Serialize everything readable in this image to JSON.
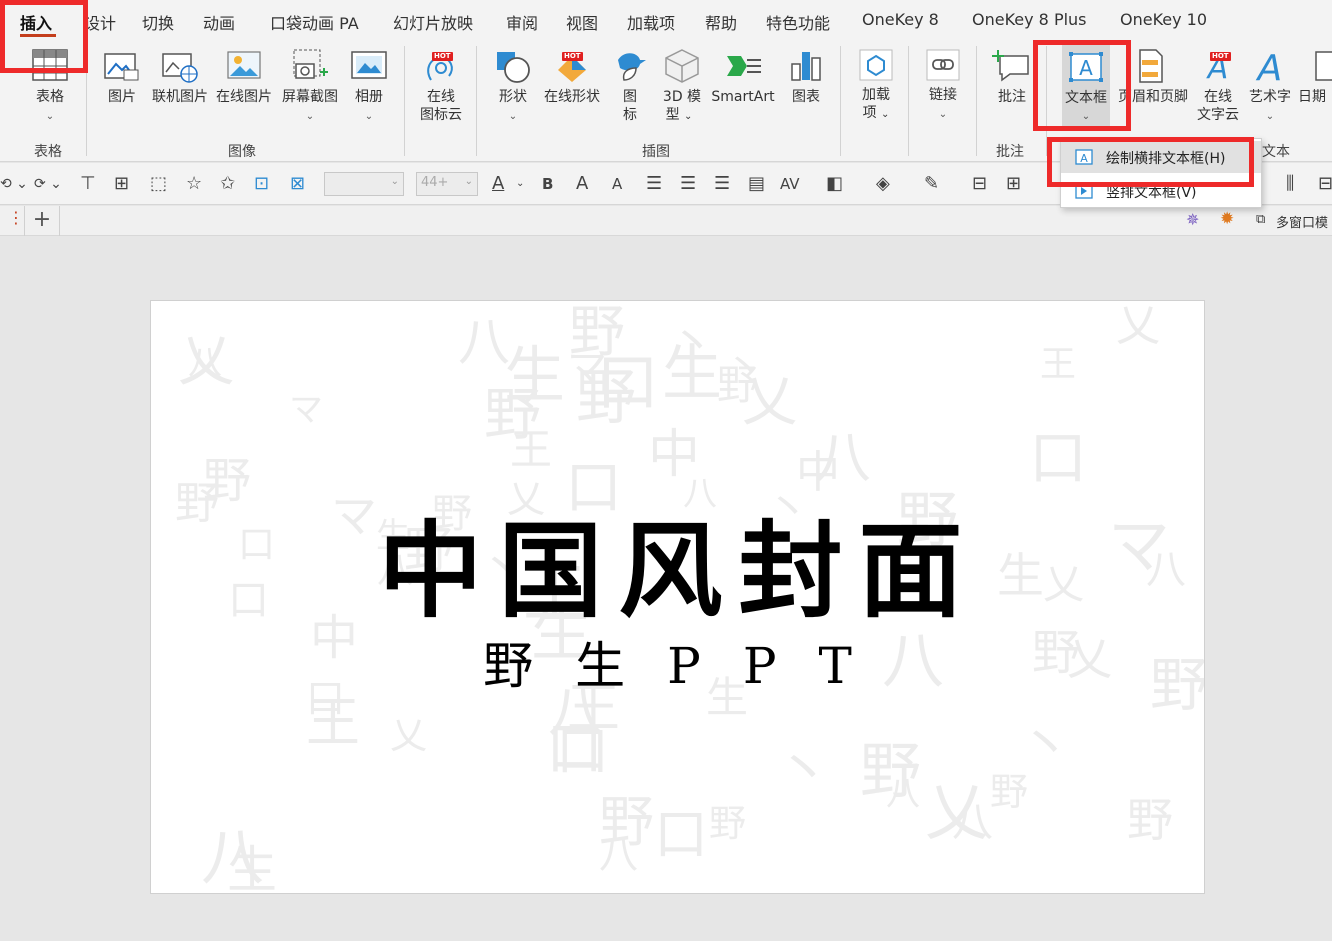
{
  "tabs": [
    {
      "label": "插入",
      "active": true
    },
    {
      "label": "设计"
    },
    {
      "label": "切换"
    },
    {
      "label": "动画"
    },
    {
      "label": "口袋动画 PA"
    },
    {
      "label": "幻灯片放映"
    },
    {
      "label": "审阅"
    },
    {
      "label": "视图"
    },
    {
      "label": "加载项"
    },
    {
      "label": "帮助"
    },
    {
      "label": "特色功能"
    },
    {
      "label": "OneKey 8"
    },
    {
      "label": "OneKey 8 Plus"
    },
    {
      "label": "OneKey 10"
    }
  ],
  "ribbon": {
    "buttons": {
      "table": "表格",
      "picture": "图片",
      "online_picture": "联机图片",
      "online_image": "在线图片",
      "screenshot": "屏幕截图",
      "album": "相册",
      "icon_cloud_l1": "在线",
      "icon_cloud_l2": "图标云",
      "shapes": "形状",
      "online_shapes": "在线形状",
      "icons_l1": "图",
      "icons_l2": "标",
      "model3d_l1": "3D 模",
      "model3d_l2": "型",
      "smartart": "SmartArt",
      "chart": "图表",
      "addins_l1": "加载",
      "addins_l2": "项",
      "link": "链接",
      "comment": "批注",
      "textbox": "文本框",
      "header_footer": "页眉和页脚",
      "online_text_l1": "在线",
      "online_text_l2": "文字云",
      "wordart": "艺术字",
      "date": "日期"
    },
    "groups": {
      "table": "表格",
      "images": "图像",
      "illustrations": "插图",
      "comments": "批注",
      "text": "文本"
    },
    "hot_badge": "HOT"
  },
  "format_bar": {
    "font_name": "",
    "font_size": "44+",
    "bold": "B",
    "grow_font": "A",
    "shrink_font": "A",
    "char_spacing": "AV"
  },
  "slide_tabs": {
    "add": "+",
    "multi_window": "多窗口模"
  },
  "dropdown": {
    "draw_horizontal": "绘制横排文本框(H)",
    "vertical": "竖排文本框(V)"
  },
  "slide": {
    "title": "中国风封面",
    "subtitle": "野生PPT"
  },
  "colors": {
    "accent_red": "#ee2a2a",
    "tab_underline": "#c43e1c",
    "icon_blue": "#1f6fc5"
  }
}
